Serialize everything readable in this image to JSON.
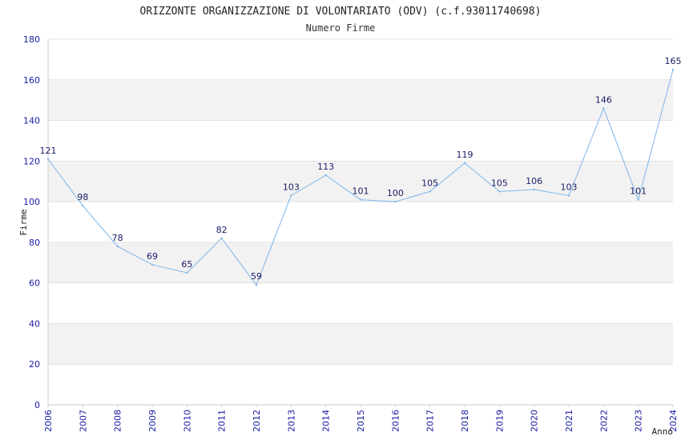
{
  "chart_data": {
    "type": "line",
    "title": "ORIZZONTE ORGANIZZAZIONE DI VOLONTARIATO (ODV) (c.f.93011740698)",
    "subtitle": "Numero Firme",
    "xlabel": "Anno",
    "ylabel": "Firme",
    "ylim": [
      0,
      180
    ],
    "yticks": [
      0,
      20,
      40,
      60,
      80,
      100,
      120,
      140,
      160,
      180
    ],
    "grid": "horizontal alternating bands",
    "categories": [
      "2006",
      "2007",
      "2008",
      "2009",
      "2010",
      "2011",
      "2012",
      "2013",
      "2014",
      "2015",
      "2016",
      "2017",
      "2018",
      "2019",
      "2020",
      "2021",
      "2022",
      "2023",
      "2024"
    ],
    "series": [
      {
        "values": [
          121,
          98,
          78,
          69,
          65,
          82,
          59,
          103,
          113,
          101,
          100,
          105,
          119,
          105,
          106,
          103,
          146,
          101,
          165
        ]
      }
    ],
    "colors": {
      "line": "#7fb6ea",
      "band": "#f2f2f2",
      "tick": "#1a1aa6",
      "label": "#1a1a66"
    }
  }
}
